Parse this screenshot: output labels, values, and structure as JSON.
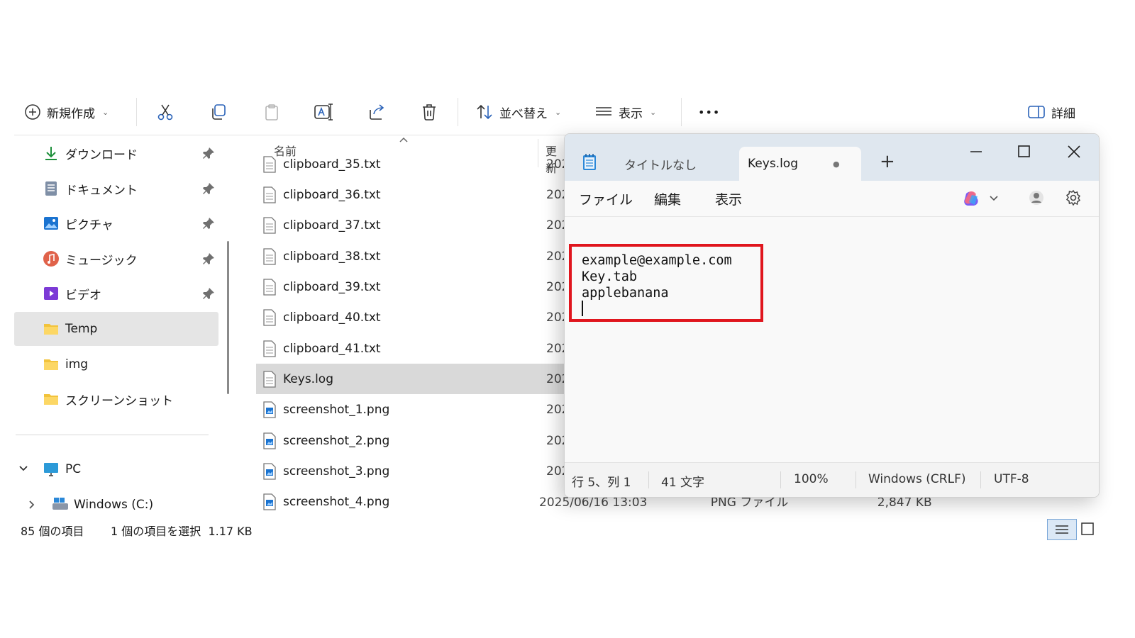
{
  "toolbar": {
    "new_label": "新規作成",
    "sort_label": "並べ替え",
    "view_label": "表示",
    "more_label": "•••",
    "details_label": "詳細"
  },
  "sidebar": {
    "items": [
      {
        "label": "ダウンロード",
        "icon": "download-icon",
        "pinned": true
      },
      {
        "label": "ドキュメント",
        "icon": "document-icon",
        "pinned": true
      },
      {
        "label": "ピクチャ",
        "icon": "picture-icon",
        "pinned": true
      },
      {
        "label": "ミュージック",
        "icon": "music-icon",
        "pinned": true
      },
      {
        "label": "ビデオ",
        "icon": "video-icon",
        "pinned": true
      },
      {
        "label": "Temp",
        "icon": "folder-icon",
        "selected": true
      },
      {
        "label": "img",
        "icon": "folder-icon"
      },
      {
        "label": "スクリーンショット",
        "icon": "folder-icon"
      }
    ],
    "pc_label": "PC",
    "drive_label": "Windows (C:)"
  },
  "filelist": {
    "col_name": "名前",
    "col_date": "更新",
    "rows": [
      {
        "name": "clipboard_35.txt",
        "date": "202",
        "type": "txt"
      },
      {
        "name": "clipboard_36.txt",
        "date": "202",
        "type": "txt"
      },
      {
        "name": "clipboard_37.txt",
        "date": "202",
        "type": "txt"
      },
      {
        "name": "clipboard_38.txt",
        "date": "202",
        "type": "txt"
      },
      {
        "name": "clipboard_39.txt",
        "date": "202",
        "type": "txt"
      },
      {
        "name": "clipboard_40.txt",
        "date": "202",
        "type": "txt"
      },
      {
        "name": "clipboard_41.txt",
        "date": "202",
        "type": "txt"
      },
      {
        "name": "Keys.log",
        "date": "202",
        "type": "log",
        "selected": true
      },
      {
        "name": "screenshot_1.png",
        "date": "202",
        "type": "png"
      },
      {
        "name": "screenshot_2.png",
        "date": "202",
        "type": "png"
      },
      {
        "name": "screenshot_3.png",
        "date": "202",
        "type": "png"
      },
      {
        "name": "screenshot_4.png",
        "date": "2025/06/16 13:03",
        "type": "png"
      }
    ],
    "last_row_type": "PNG ファイル",
    "last_row_size": "2,847 KB"
  },
  "statusbar": {
    "item_count": "85 個の項目",
    "selection": "1 個の項目を選択  1.17 KB"
  },
  "notepad": {
    "tabs": [
      {
        "label": "タイトルなし",
        "active": false
      },
      {
        "label": "Keys.log",
        "active": true,
        "modified_dot": "●"
      }
    ],
    "new_tab": "+",
    "menu": {
      "file": "ファイル",
      "edit": "編集",
      "view": "表示"
    },
    "content": "example@example.com\nKey.tab\napplebanana",
    "status": {
      "position": "行 5、列 1",
      "chars": "41 文字",
      "zoom": "100%",
      "eol": "Windows (CRLF)",
      "encoding": "UTF-8"
    },
    "highlight_color": "#e0161e"
  }
}
